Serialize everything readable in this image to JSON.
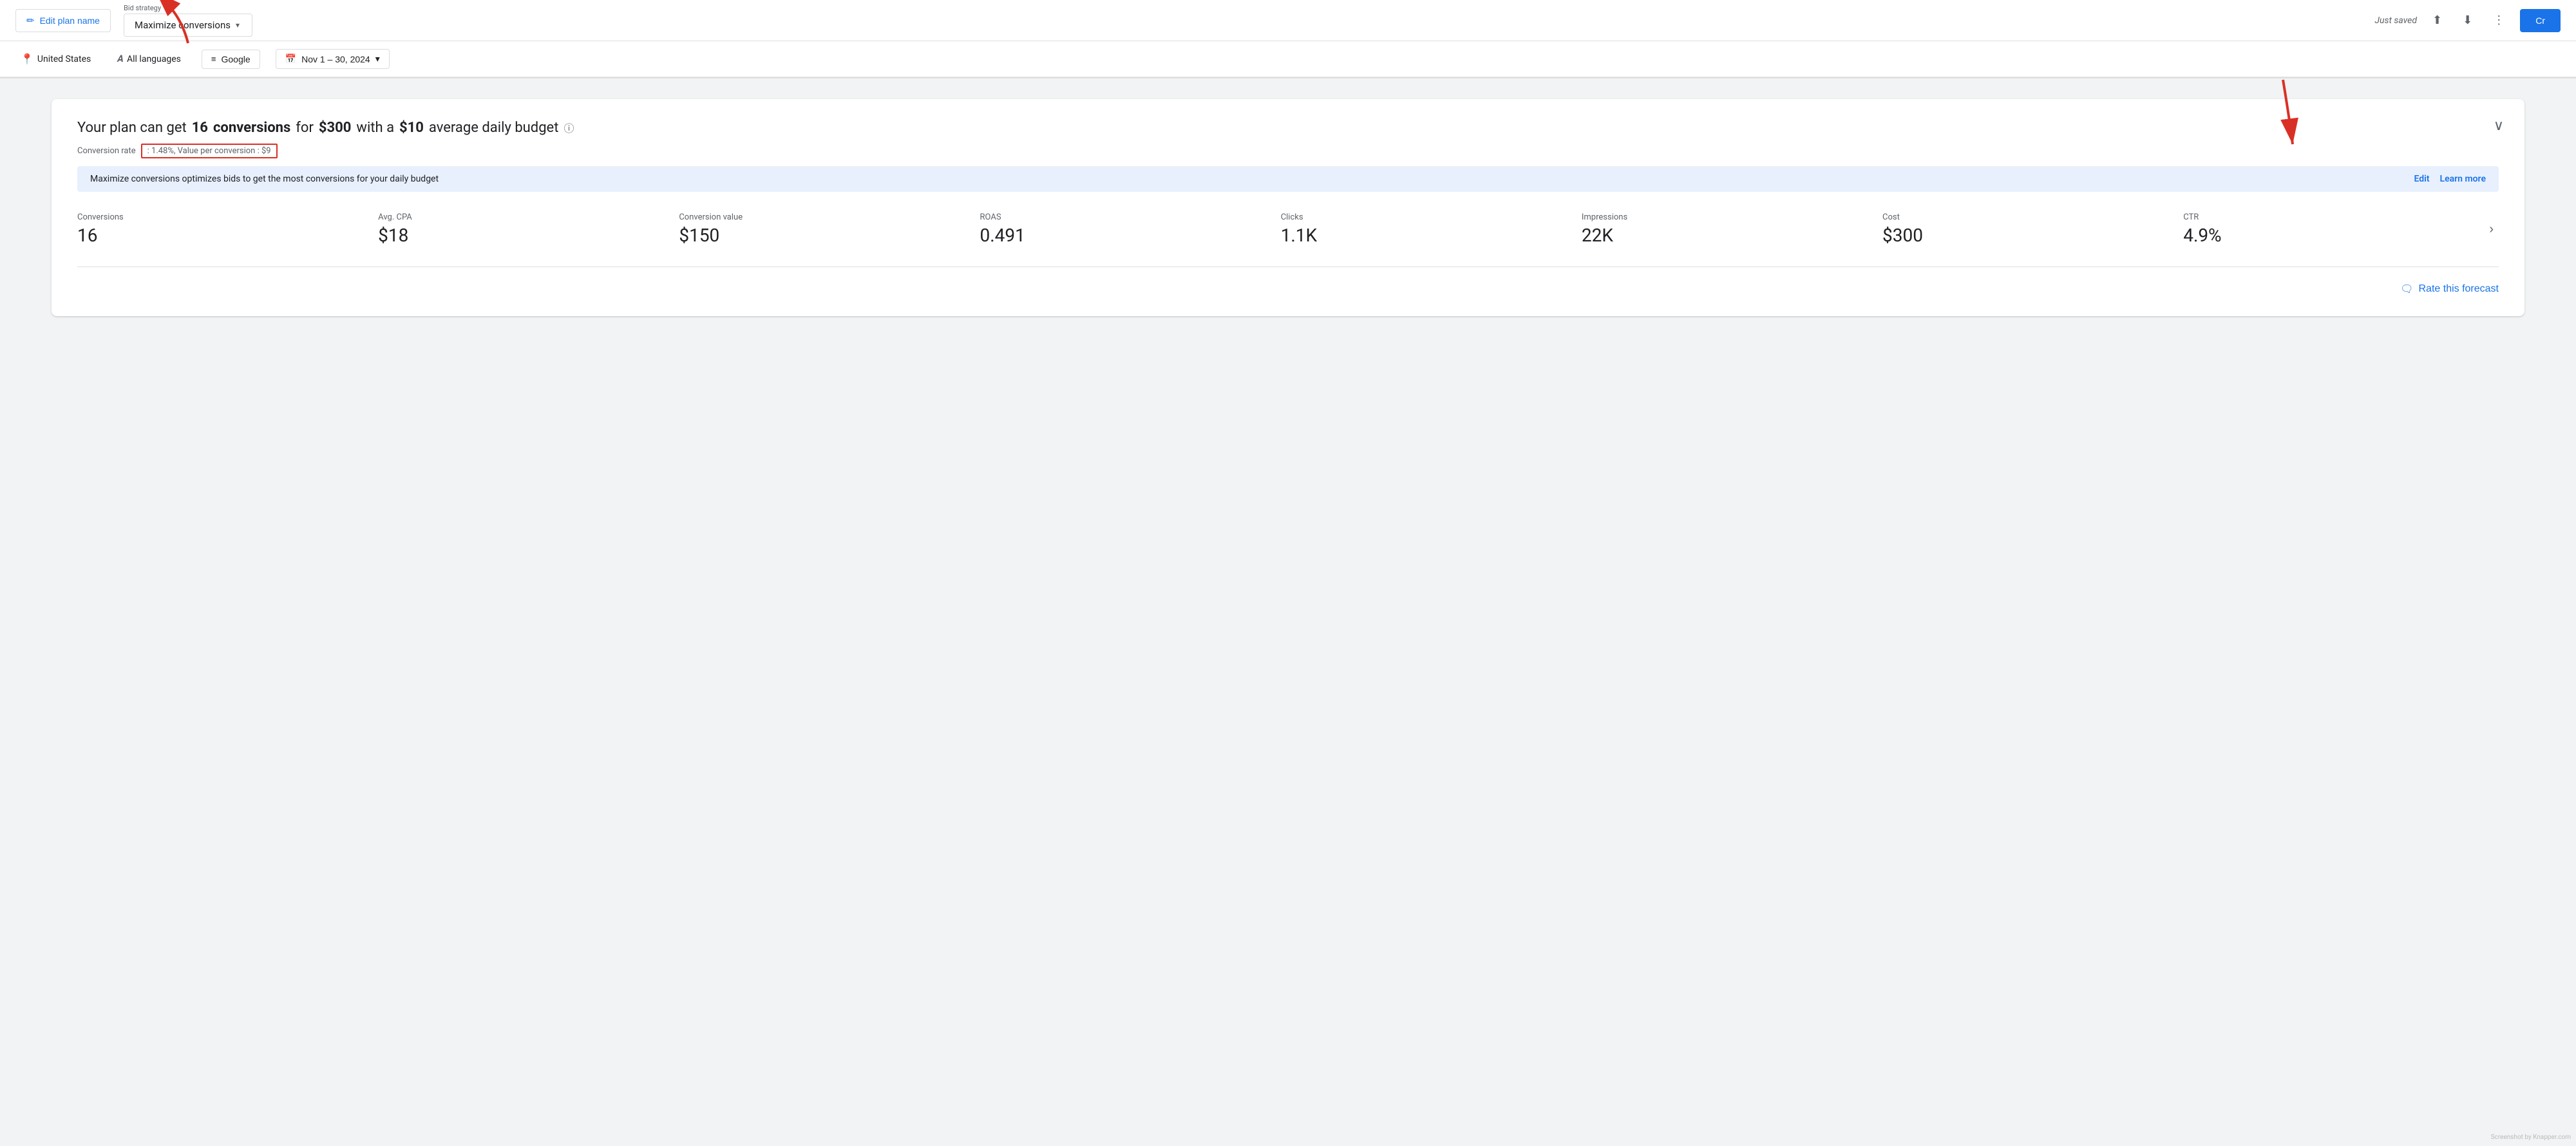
{
  "topbar": {
    "edit_plan_label": "Edit plan name",
    "bid_strategy_label": "Bid strategy",
    "bid_strategy_value": "Maximize conversions",
    "just_saved": "Just saved",
    "create_label": "Cr"
  },
  "filters": {
    "location": "United States",
    "languages": "All languages",
    "network": "Google",
    "date_range": "Nov 1 – 30, 2024"
  },
  "forecast": {
    "headline_pre": "Your plan can get",
    "conversions_count": "16",
    "conversions_label": "conversions",
    "for_label": "for",
    "cost": "$300",
    "with_label": "with a",
    "daily_budget": "$10",
    "daily_budget_suffix": "average daily budget",
    "conversion_rate_pre": "Conversion rate",
    "conversion_rate_value": ": 1.48%, Value per conversion : $9",
    "info_banner_text": "Maximize conversions optimizes bids to get the most conversions for your daily budget",
    "edit_label": "Edit",
    "learn_more_label": "Learn more",
    "metrics": [
      {
        "label": "Conversions",
        "value": "16"
      },
      {
        "label": "Avg. CPA",
        "value": "$18"
      },
      {
        "label": "Conversion value",
        "value": "$150"
      },
      {
        "label": "ROAS",
        "value": "0.491"
      },
      {
        "label": "Clicks",
        "value": "1.1K"
      },
      {
        "label": "Impressions",
        "value": "22K"
      },
      {
        "label": "Cost",
        "value": "$300"
      },
      {
        "label": "CTR",
        "value": "4.9%"
      }
    ],
    "rate_forecast_label": "Rate this forecast"
  },
  "icons": {
    "pencil": "✏",
    "location": "📍",
    "language": "𝐴",
    "google_search": "≡🔍",
    "calendar": "📅",
    "chevron_down": "▾",
    "upload": "⬆",
    "download": "⬇",
    "more_vert": "⋮",
    "expand_less": "∨",
    "chevron_right": "›",
    "chat_bubble": "🗨"
  }
}
